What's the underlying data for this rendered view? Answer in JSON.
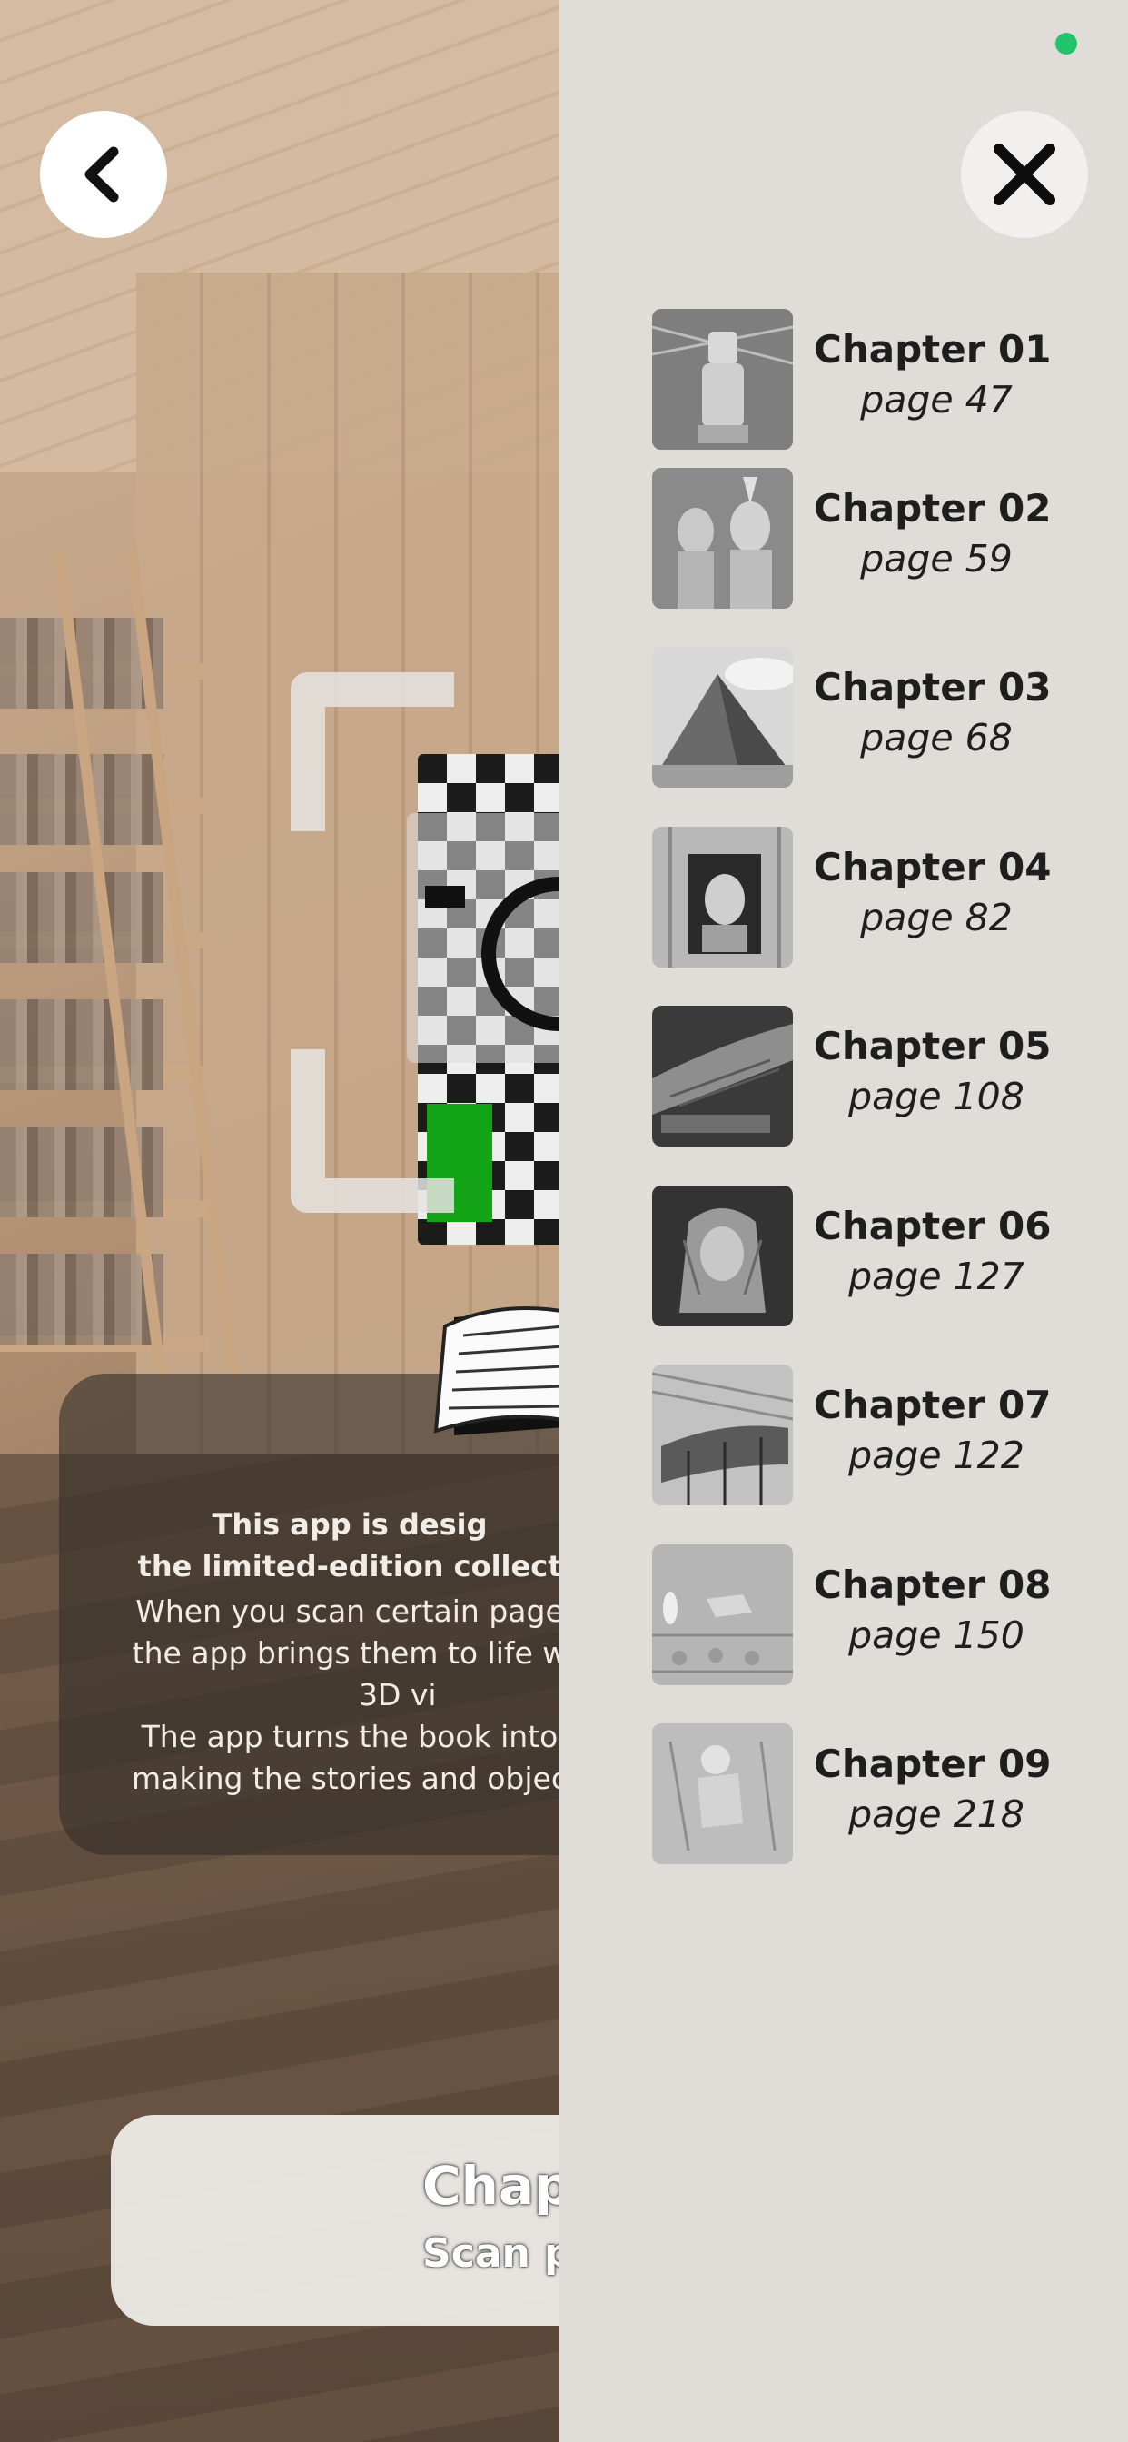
{
  "info": {
    "bold_line1": "This app is desig",
    "bold_line2": "the limited-edition collect",
    "line1": "When you scan certain page",
    "line2": "the app brings them to life w",
    "line3": "3D vi",
    "line4": "The app turns the book into",
    "line5": "making the stories and objec"
  },
  "bottom_bar": {
    "title": "Chapt",
    "subtitle": "Scan p"
  },
  "chapters": [
    {
      "title": "Chapter 01",
      "page": "page 47"
    },
    {
      "title": "Chapter 02",
      "page": "page 59"
    },
    {
      "title": "Chapter 03",
      "page": "page 68"
    },
    {
      "title": "Chapter 04",
      "page": "page 82"
    },
    {
      "title": "Chapter 05",
      "page": "page 108"
    },
    {
      "title": "Chapter 06",
      "page": "page 127"
    },
    {
      "title": "Chapter 07",
      "page": "page 122"
    },
    {
      "title": "Chapter 08",
      "page": "page 150"
    },
    {
      "title": "Chapter 09",
      "page": "page 218"
    }
  ],
  "icons": {
    "back": "chevron-left-icon",
    "close": "close-icon",
    "camera": "camera-icon",
    "book": "open-book-icon"
  },
  "colors": {
    "drawer_bg": "#e0ddd8",
    "status_dot": "#22c46b",
    "accent_green": "#12a316"
  }
}
